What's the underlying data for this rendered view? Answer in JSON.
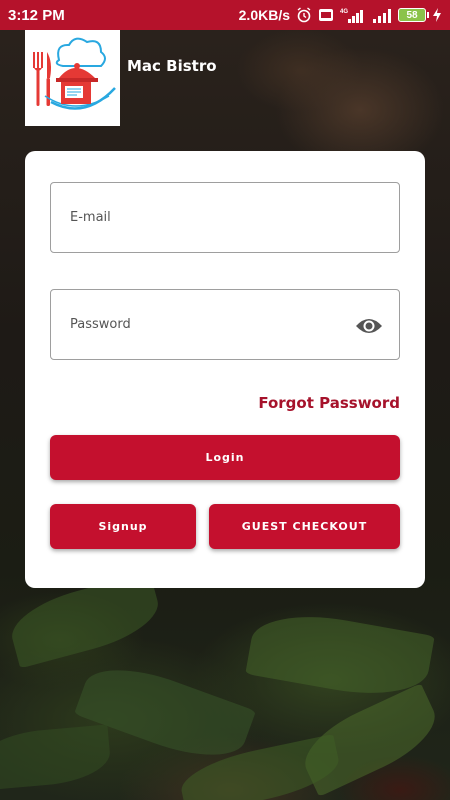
{
  "status_bar": {
    "time": "3:12 PM",
    "network_speed": "2.0KB/s",
    "network_type": "4G",
    "battery": "58",
    "icons": [
      "alarm-icon",
      "volte-icon",
      "signal-icon",
      "signal-icon",
      "battery-icon",
      "charging-icon"
    ]
  },
  "header": {
    "app_name": "Mac Bistro",
    "logo": "chef-hat-logo"
  },
  "login_form": {
    "email_placeholder": "E-mail",
    "email_value": "",
    "password_placeholder": "Password",
    "password_value": "",
    "toggle_visibility_icon": "eye-icon",
    "forgot_password_label": "Forgot Password",
    "login_label": "Login",
    "signup_label": "Signup",
    "guest_checkout_label": "GUEST CHECKOUT"
  },
  "colors": {
    "brand": "#c4102e",
    "status_bar": "#b5122b",
    "link": "#a6122b"
  }
}
